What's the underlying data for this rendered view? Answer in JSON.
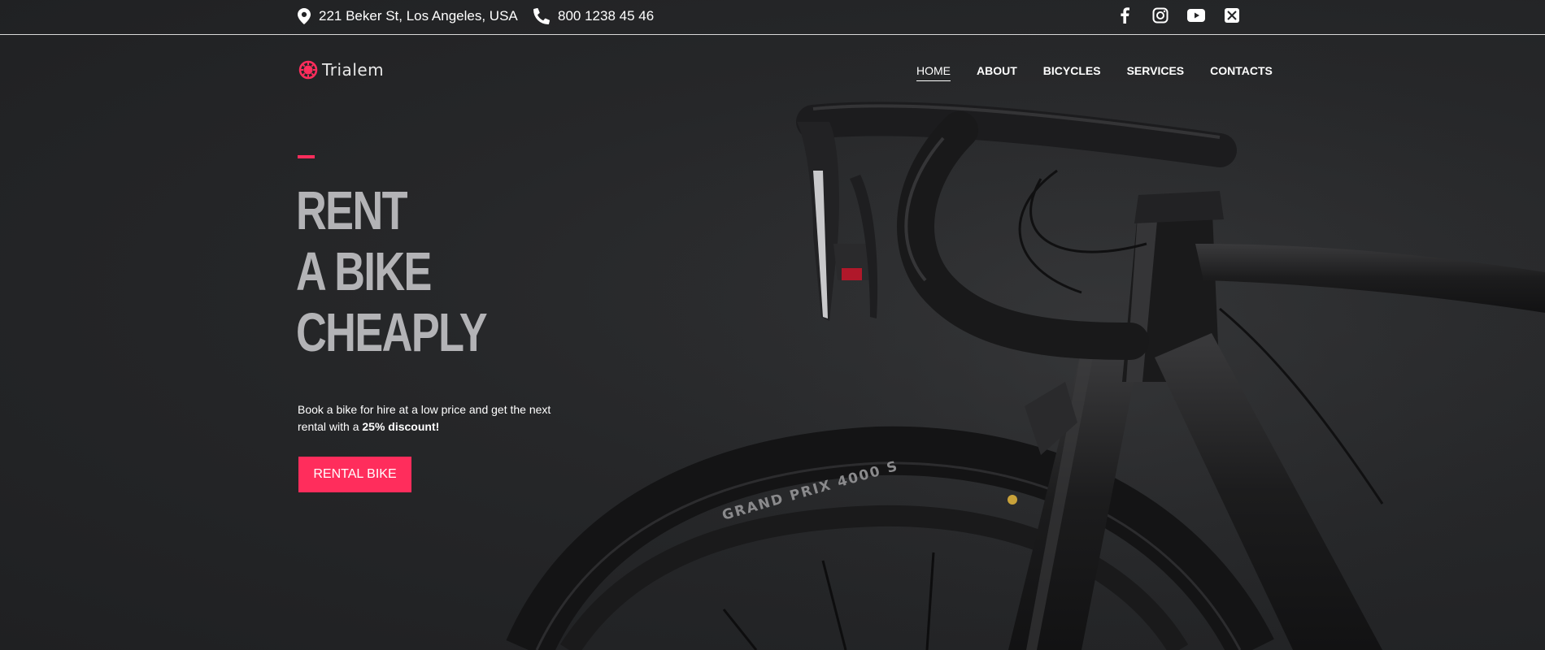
{
  "topbar": {
    "address": "221 Beker St, Los Angeles, USA",
    "phone": "800 1238 45 46",
    "socials": [
      "facebook-icon",
      "instagram-icon",
      "youtube-icon",
      "x-icon"
    ]
  },
  "brand": {
    "name": "Trialem",
    "accent": "#ff2d5c"
  },
  "nav": {
    "items": [
      "HOME",
      "ABOUT",
      "BICYCLES",
      "SERVICES",
      "CONTACTS"
    ],
    "active": "HOME"
  },
  "hero": {
    "title_lines": [
      "RENT",
      "A BIKE",
      "CHEAPLY"
    ],
    "description_prefix": "Book a bike for hire at a low price and get the next rental with a ",
    "description_bold": "25% discount!",
    "cta": "RENTAL BIKE",
    "tire_text": "GRAND PRIX 4000 S"
  },
  "colors": {
    "background": "#232426",
    "title": "#b3b3b6",
    "text": "#ffffff"
  }
}
